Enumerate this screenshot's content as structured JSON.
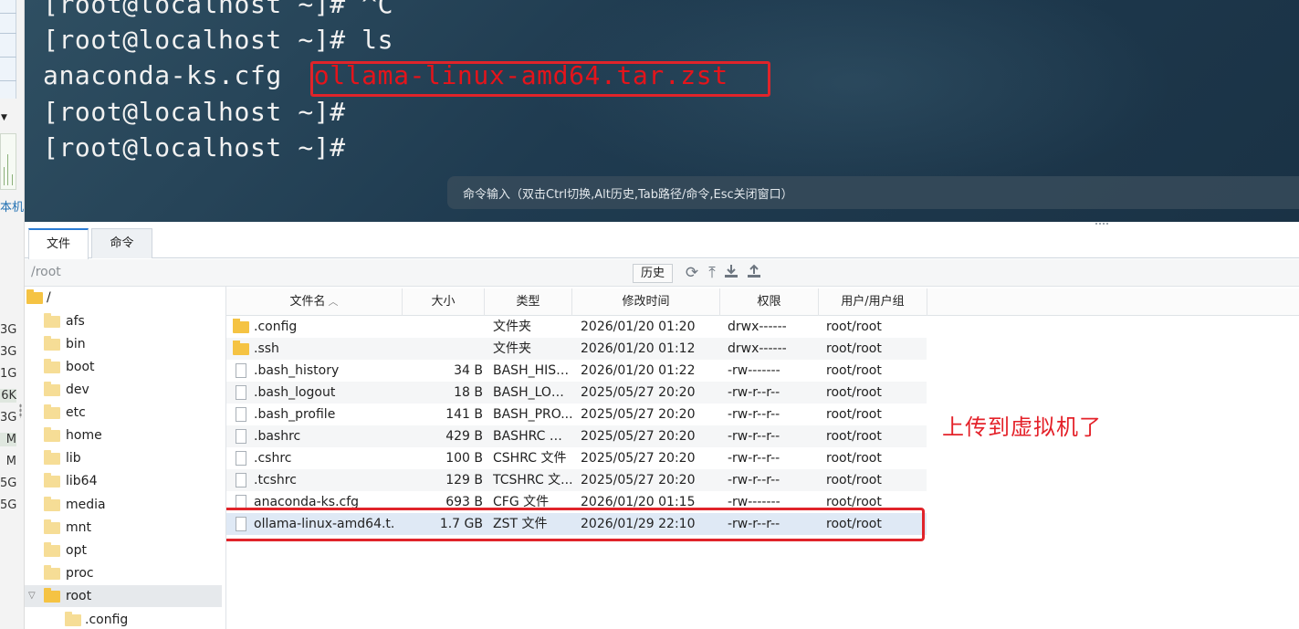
{
  "left_strip": {
    "label_ji": "本机",
    "values": [
      "3G",
      "3G",
      "1G",
      "6K",
      "3G",
      "M",
      "M",
      "5G",
      "5G"
    ]
  },
  "terminal": {
    "lines": [
      {
        "prompt": "[root@localhost ~]#",
        "command": " ^C"
      },
      {
        "prompt": "[root@localhost ~]#",
        "command": " ls"
      },
      {
        "plain": "anaconda-ks.cfg  ",
        "highlighted": "ollama-linux-amd64.tar.zst"
      },
      {
        "prompt": "[root@localhost ~]#",
        "command": ""
      },
      {
        "prompt": "[root@localhost ~]#",
        "command": ""
      }
    ],
    "command_bar_hint": "命令输入（双击Ctrl切换,Alt历史,Tab路径/命令,Esc关闭窗口）",
    "highlight_color": "#e0242a"
  },
  "tabs": [
    {
      "label": "文件",
      "active": true
    },
    {
      "label": "命令",
      "active": false
    }
  ],
  "path_bar": {
    "path": "/root",
    "history_label": "历史",
    "tools": [
      "refresh-icon",
      "up-dir-icon",
      "download-icon",
      "upload-icon"
    ]
  },
  "tree": {
    "root_label": "/",
    "items": [
      "afs",
      "bin",
      "boot",
      "dev",
      "etc",
      "home",
      "lib",
      "lib64",
      "media",
      "mnt",
      "opt",
      "proc",
      "root"
    ],
    "selected": "root",
    "child_of_root": ".config"
  },
  "file_list": {
    "columns": [
      "文件名",
      "大小",
      "类型",
      "修改时间",
      "权限",
      "用户/用户组"
    ],
    "rows": [
      {
        "name": ".config",
        "size": "",
        "type": "文件夹",
        "modified": "2026/01/20 01:20",
        "perm": "drwx------",
        "owner": "root/root",
        "kind": "folder"
      },
      {
        "name": ".ssh",
        "size": "",
        "type": "文件夹",
        "modified": "2026/01/20 01:12",
        "perm": "drwx------",
        "owner": "root/root",
        "kind": "folder"
      },
      {
        "name": ".bash_history",
        "size": "34 B",
        "type": "BASH_HIST...",
        "modified": "2026/01/20 01:22",
        "perm": "-rw-------",
        "owner": "root/root",
        "kind": "file"
      },
      {
        "name": ".bash_logout",
        "size": "18 B",
        "type": "BASH_LOG...",
        "modified": "2025/05/27 20:20",
        "perm": "-rw-r--r--",
        "owner": "root/root",
        "kind": "file"
      },
      {
        "name": ".bash_profile",
        "size": "141 B",
        "type": "BASH_PRO...",
        "modified": "2025/05/27 20:20",
        "perm": "-rw-r--r--",
        "owner": "root/root",
        "kind": "file"
      },
      {
        "name": ".bashrc",
        "size": "429 B",
        "type": "BASHRC 文...",
        "modified": "2025/05/27 20:20",
        "perm": "-rw-r--r--",
        "owner": "root/root",
        "kind": "file"
      },
      {
        "name": ".cshrc",
        "size": "100 B",
        "type": "CSHRC 文件",
        "modified": "2025/05/27 20:20",
        "perm": "-rw-r--r--",
        "owner": "root/root",
        "kind": "file"
      },
      {
        "name": ".tcshrc",
        "size": "129 B",
        "type": "TCSHRC 文...",
        "modified": "2025/05/27 20:20",
        "perm": "-rw-r--r--",
        "owner": "root/root",
        "kind": "file"
      },
      {
        "name": "anaconda-ks.cfg",
        "size": "693 B",
        "type": "CFG 文件",
        "modified": "2026/01/20 01:15",
        "perm": "-rw-------",
        "owner": "root/root",
        "kind": "file"
      },
      {
        "name": "ollama-linux-amd64.t...",
        "size": "1.7 GB",
        "type": "ZST 文件",
        "modified": "2026/01/29 22:10",
        "perm": "-rw-r--r--",
        "owner": "root/root",
        "kind": "file"
      }
    ],
    "selected_index": 9
  },
  "annotation": {
    "text": "上传到虚拟机了",
    "color": "#e4222a"
  }
}
